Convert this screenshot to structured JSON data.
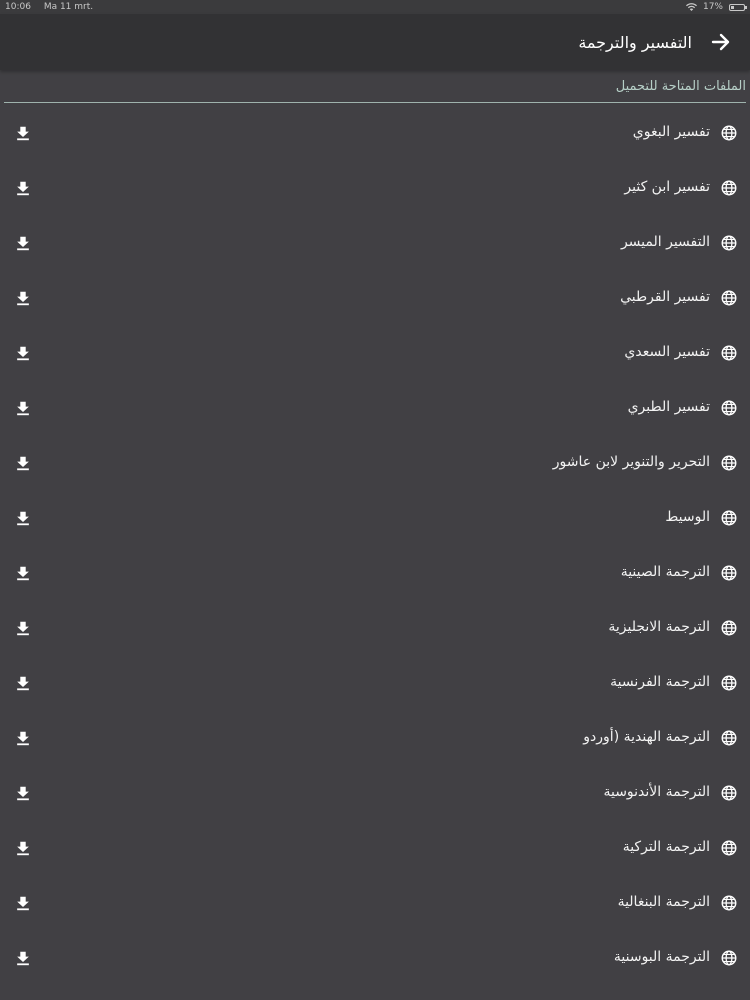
{
  "status_bar": {
    "time": "10:06",
    "date": "Ma 11 mrt.",
    "battery": "17%"
  },
  "app_bar": {
    "title": "التفسير والترجمة"
  },
  "section": {
    "title": "الملفات المتاحة للتحميل"
  },
  "items": [
    {
      "label": "تفسير البغوي"
    },
    {
      "label": "تفسير ابن كثير"
    },
    {
      "label": "التفسير الميسر"
    },
    {
      "label": "تفسير القرطبي"
    },
    {
      "label": "تفسير السعدي"
    },
    {
      "label": "تفسير الطبري"
    },
    {
      "label": "التحرير والتنوير لابن عاشور"
    },
    {
      "label": "الوسيط"
    },
    {
      "label": "الترجمة الصينية"
    },
    {
      "label": "الترجمة الانجليزية"
    },
    {
      "label": "الترجمة الفرنسية"
    },
    {
      "label": "الترجمة الهندية (أوردو"
    },
    {
      "label": "الترجمة الأندنوسية"
    },
    {
      "label": "الترجمة التركية"
    },
    {
      "label": "الترجمة البنغالية"
    },
    {
      "label": "الترجمة البوسنية"
    }
  ],
  "icons": {
    "item_leading": "globe-icon",
    "item_trailing": "download-icon",
    "back": "arrow-right-icon"
  },
  "colors": {
    "background": "#414044",
    "app_bar": "#323234",
    "section_title": "#b6cfc7"
  }
}
